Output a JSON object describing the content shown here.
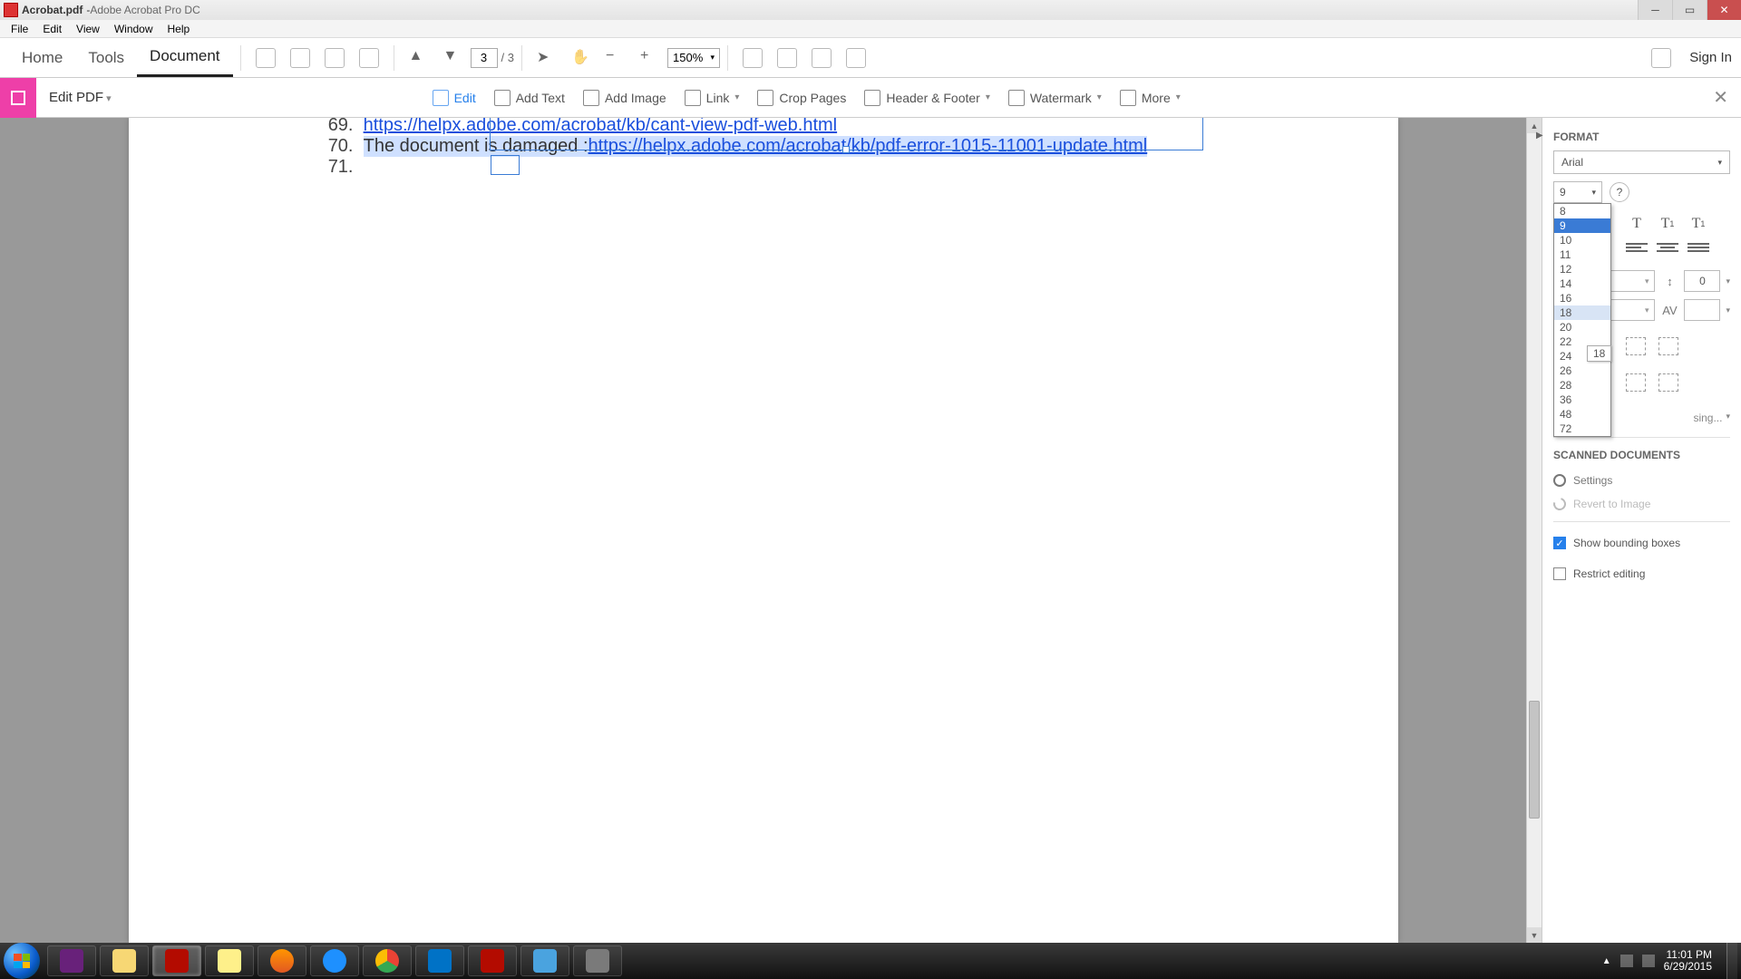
{
  "titlebar": {
    "filename": "Acrobat.pdf",
    "appname": "Adobe Acrobat Pro DC"
  },
  "menubar": [
    "File",
    "Edit",
    "View",
    "Window",
    "Help"
  ],
  "nav": {
    "tabs": {
      "home": "Home",
      "tools": "Tools",
      "document": "Document"
    },
    "page_current": "3",
    "page_total": "/ 3",
    "zoom": "150%",
    "signin": "Sign In"
  },
  "edit_toolbar": {
    "label": "Edit PDF",
    "edit": "Edit",
    "add_text": "Add Text",
    "add_image": "Add Image",
    "link": "Link",
    "crop": "Crop Pages",
    "header_footer": "Header & Footer",
    "watermark": "Watermark",
    "more": "More"
  },
  "document": {
    "line69": {
      "num": "69.",
      "url": "https://helpx.adobe.com/acrobat/kb/cant-view-pdf-web.html"
    },
    "line70": {
      "num": "70.",
      "text": "The document is damaged : ",
      "url": "https://helpx.adobe.com/acrobat/kb/pdf-error-1015-11001-update.html"
    },
    "line71": {
      "num": "71."
    }
  },
  "format": {
    "title": "FORMAT",
    "font": "Arial",
    "size": "9",
    "sizes": [
      "8",
      "9",
      "10",
      "11",
      "12",
      "14",
      "16",
      "18",
      "20",
      "22",
      "24",
      "26",
      "28",
      "36",
      "48",
      "72"
    ],
    "size_selected": "9",
    "size_hover": "18",
    "tooltip": "18",
    "spacing_value": "0",
    "using": "sing...",
    "scanned_title": "SCANNED DOCUMENTS",
    "settings": "Settings",
    "revert": "Revert to Image",
    "show_bounding": "Show bounding boxes",
    "restrict": "Restrict editing"
  },
  "tray": {
    "time": "11:01 PM",
    "date": "6/29/2015"
  }
}
